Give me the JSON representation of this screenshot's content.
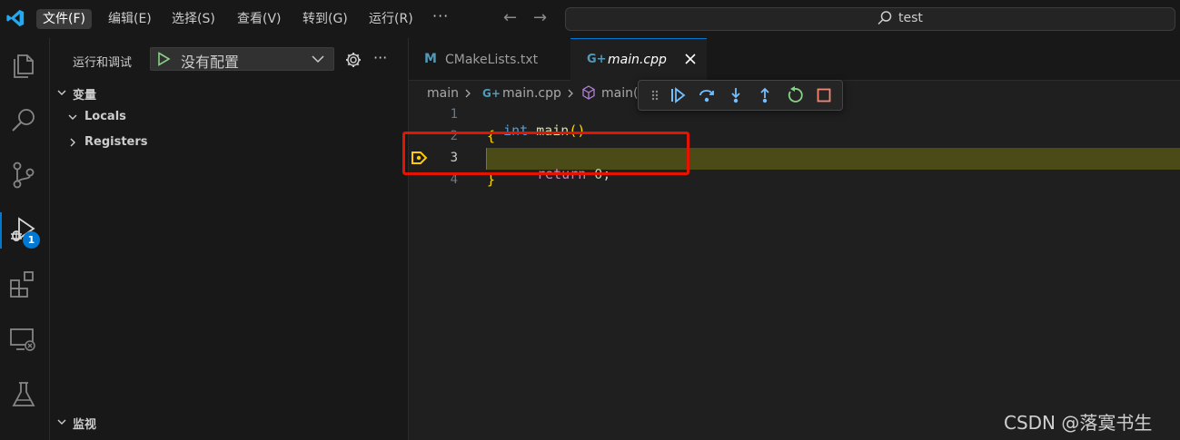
{
  "menu": {
    "items": [
      "文件(F)",
      "编辑(E)",
      "选择(S)",
      "查看(V)",
      "转到(G)",
      "运行(R)"
    ],
    "more": "···"
  },
  "nav": {
    "back": "←",
    "forward": "→"
  },
  "search": {
    "text": "test"
  },
  "activity": {
    "debug_badge": "1"
  },
  "sidebar": {
    "title": "运行和调试",
    "config": "没有配置",
    "more": "···",
    "variables_header": "变量",
    "tree": [
      "Locals",
      "Registers"
    ],
    "watch_header": "监视"
  },
  "tabs": [
    {
      "icon": "M",
      "label": "CMakeLists.txt"
    },
    {
      "icon": "G+",
      "label": "main.cpp"
    }
  ],
  "breadcrumb": {
    "folder": "main",
    "file": "main.cpp",
    "symbol": "main("
  },
  "code": {
    "lines": [
      "1",
      "2",
      "3",
      "4"
    ],
    "line1_kw": "int",
    "line1_fn": "main",
    "line1_paren": "()",
    "line2": "{",
    "line3_kw": "return",
    "line3_num": "0",
    "line3_semi": ";",
    "line4": "}"
  },
  "colors": {
    "accent": "#0078d4",
    "current_line": "#4b4b18",
    "highlight_box": "#e51400"
  },
  "watermark": "CSDN @落寞书生"
}
